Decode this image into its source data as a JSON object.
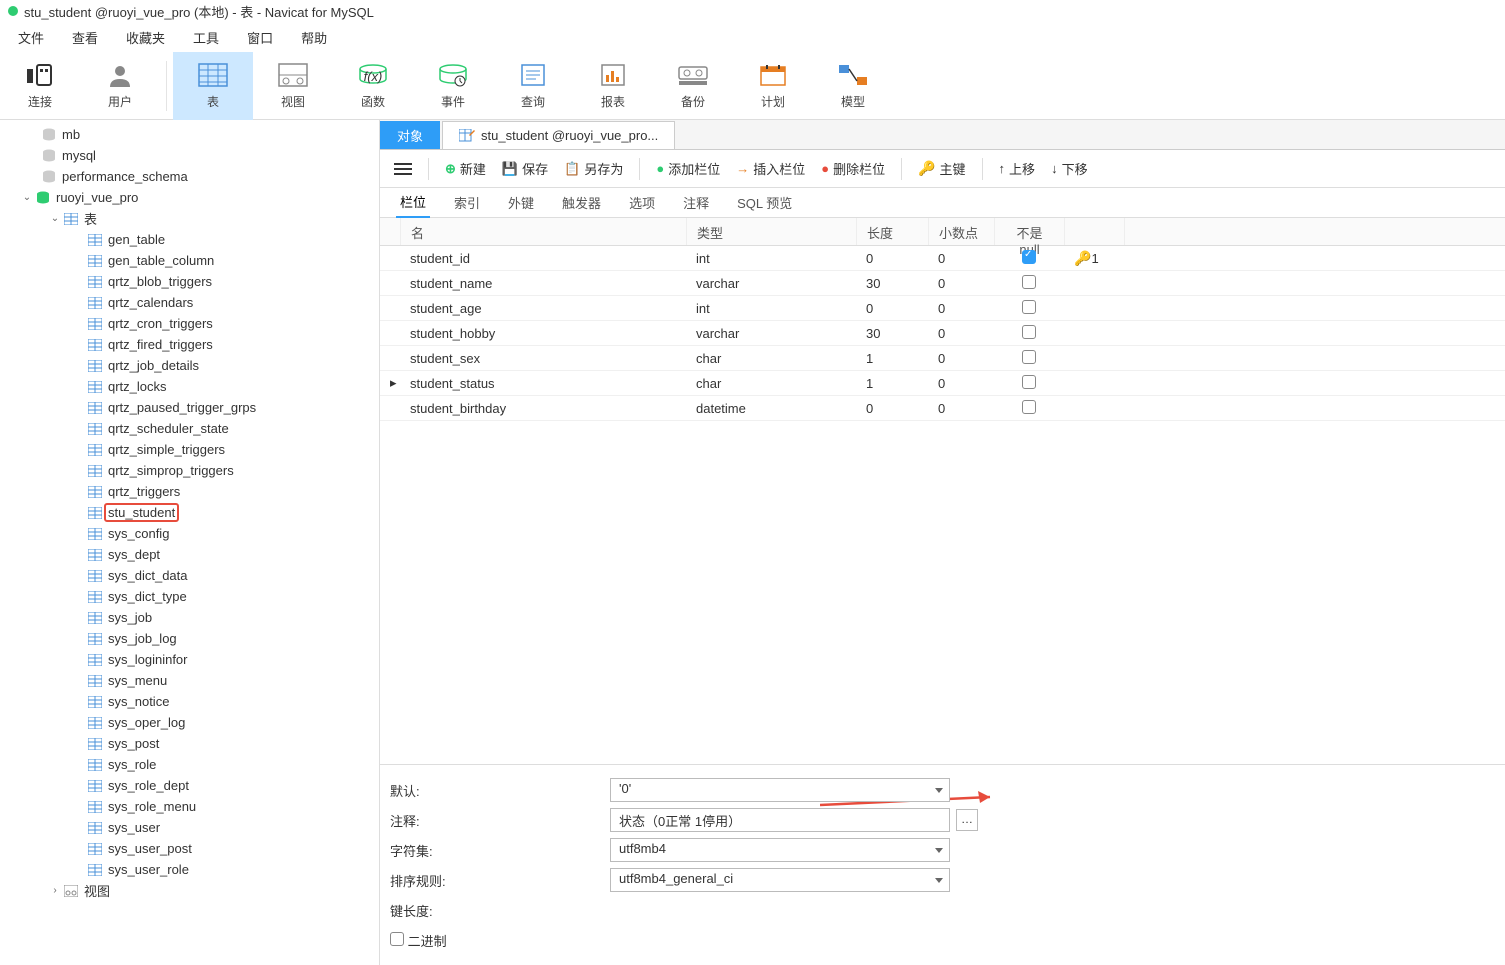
{
  "title": "stu_student @ruoyi_vue_pro (本地) - 表 - Navicat for MySQL",
  "menu": {
    "file": "文件",
    "view": "查看",
    "fav": "收藏夹",
    "tools": "工具",
    "window": "窗口",
    "help": "帮助"
  },
  "toolbar": {
    "conn": "连接",
    "user": "用户",
    "table": "表",
    "view": "视图",
    "func": "函数",
    "event": "事件",
    "query": "查询",
    "report": "报表",
    "backup": "备份",
    "plan": "计划",
    "model": "模型"
  },
  "tree": {
    "dbs": [
      "mb",
      "mysql",
      "performance_schema"
    ],
    "conn": "ruoyi_vue_pro",
    "group": "表",
    "view_group": "视图",
    "tables": [
      "gen_table",
      "gen_table_column",
      "qrtz_blob_triggers",
      "qrtz_calendars",
      "qrtz_cron_triggers",
      "qrtz_fired_triggers",
      "qrtz_job_details",
      "qrtz_locks",
      "qrtz_paused_trigger_grps",
      "qrtz_scheduler_state",
      "qrtz_simple_triggers",
      "qrtz_simprop_triggers",
      "qrtz_triggers",
      "stu_student",
      "sys_config",
      "sys_dept",
      "sys_dict_data",
      "sys_dict_type",
      "sys_job",
      "sys_job_log",
      "sys_logininfor",
      "sys_menu",
      "sys_notice",
      "sys_oper_log",
      "sys_post",
      "sys_role",
      "sys_role_dept",
      "sys_role_menu",
      "sys_user",
      "sys_user_post",
      "sys_user_role"
    ]
  },
  "tabs": {
    "obj": "对象",
    "editor": "stu_student @ruoyi_vue_pro..."
  },
  "subtoolbar": {
    "new": "新建",
    "save": "保存",
    "saveas": "另存为",
    "addcol": "添加栏位",
    "inscol": "插入栏位",
    "delcol": "删除栏位",
    "pk": "主键",
    "up": "上移",
    "down": "下移"
  },
  "subtabs": {
    "cols": "栏位",
    "idx": "索引",
    "fk": "外键",
    "trig": "触发器",
    "opts": "选项",
    "comment": "注释",
    "sql": "SQL 预览"
  },
  "grid": {
    "headers": {
      "name": "名",
      "type": "类型",
      "len": "长度",
      "dec": "小数点",
      "null": "不是 null"
    },
    "rows": [
      {
        "name": "student_id",
        "type": "int",
        "len": "0",
        "dec": "0",
        "null": true,
        "pk": "1",
        "cur": false
      },
      {
        "name": "student_name",
        "type": "varchar",
        "len": "30",
        "dec": "0",
        "null": false,
        "cur": false
      },
      {
        "name": "student_age",
        "type": "int",
        "len": "0",
        "dec": "0",
        "null": false,
        "cur": false
      },
      {
        "name": "student_hobby",
        "type": "varchar",
        "len": "30",
        "dec": "0",
        "null": false,
        "cur": false
      },
      {
        "name": "student_sex",
        "type": "char",
        "len": "1",
        "dec": "0",
        "null": false,
        "cur": false
      },
      {
        "name": "student_status",
        "type": "char",
        "len": "1",
        "dec": "0",
        "null": false,
        "cur": true
      },
      {
        "name": "student_birthday",
        "type": "datetime",
        "len": "0",
        "dec": "0",
        "null": false,
        "cur": false
      }
    ]
  },
  "props": {
    "default_l": "默认:",
    "default_v": "'0'",
    "comment_l": "注释:",
    "comment_v": "状态（0正常 1停用）",
    "charset_l": "字符集:",
    "charset_v": "utf8mb4",
    "collate_l": "排序规则:",
    "collate_v": "utf8mb4_general_ci",
    "keylen_l": "键长度:",
    "binary_l": "二进制"
  }
}
